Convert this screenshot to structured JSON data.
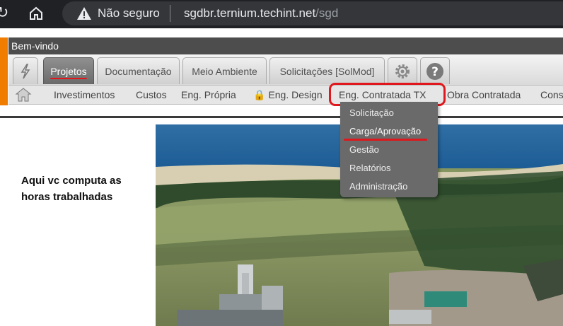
{
  "browser": {
    "reload_icon": "reload-icon",
    "home_icon": "home-icon",
    "security_label": "Não seguro",
    "url_host": "sgdbr.ternium.techint.net",
    "url_path": "/sgd"
  },
  "app": {
    "welcome": "Bem-vindo",
    "tabs": [
      {
        "label": "Projetos",
        "active": true
      },
      {
        "label": "Documentação",
        "active": false
      },
      {
        "label": "Meio Ambiente",
        "active": false
      },
      {
        "label": "Solicitações [SolMod]",
        "active": false
      }
    ],
    "tab_icons": [
      "bolt-icon",
      "gear-icon",
      "help-icon"
    ],
    "submenu": [
      "Investimentos",
      "Custos",
      "Eng. Própria",
      "Eng. Design",
      "Eng. Contratada TX",
      "Obra Contratada",
      "Cons"
    ],
    "dropdown": [
      "Solicitação",
      "Carga/Aprovação",
      "Gestão",
      "Relatórios",
      "Administração"
    ]
  },
  "content": {
    "caption": "Aqui vc computa as horas trabalhadas"
  },
  "colors": {
    "highlight": "#e0171c",
    "logo": "#f07c00",
    "dropdown_bg": "#6a6a6a"
  }
}
